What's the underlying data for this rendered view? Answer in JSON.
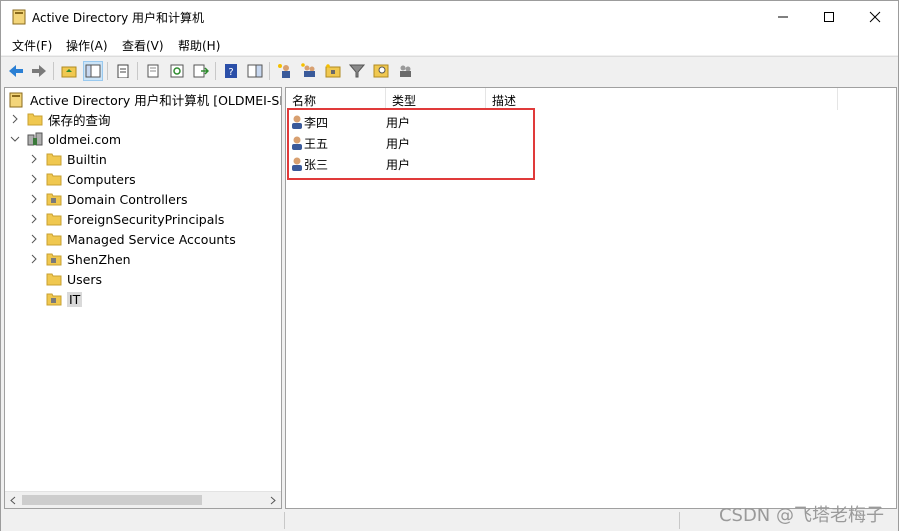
{
  "window": {
    "title": "Active Directory 用户和计算机"
  },
  "menu": [
    "文件(F)",
    "操作(A)",
    "查看(V)",
    "帮助(H)"
  ],
  "tree": {
    "root": "Active Directory 用户和计算机 [OLDMEI-SER",
    "saved_queries": "保存的查询",
    "domain": "oldmei.com",
    "children": [
      "Builtin",
      "Computers",
      "Domain Controllers",
      "ForeignSecurityPrincipals",
      "Managed Service Accounts",
      "ShenZhen",
      "Users",
      "IT"
    ]
  },
  "list": {
    "columns": [
      "名称",
      "类型",
      "描述"
    ],
    "rows": [
      {
        "name": "李四",
        "type": "用户"
      },
      {
        "name": "王五",
        "type": "用户"
      },
      {
        "name": "张三",
        "type": "用户"
      }
    ]
  },
  "watermark": "CSDN @飞塔老梅子",
  "colors": {
    "highlight": "#e03a3a",
    "folder": "#f0c850"
  }
}
